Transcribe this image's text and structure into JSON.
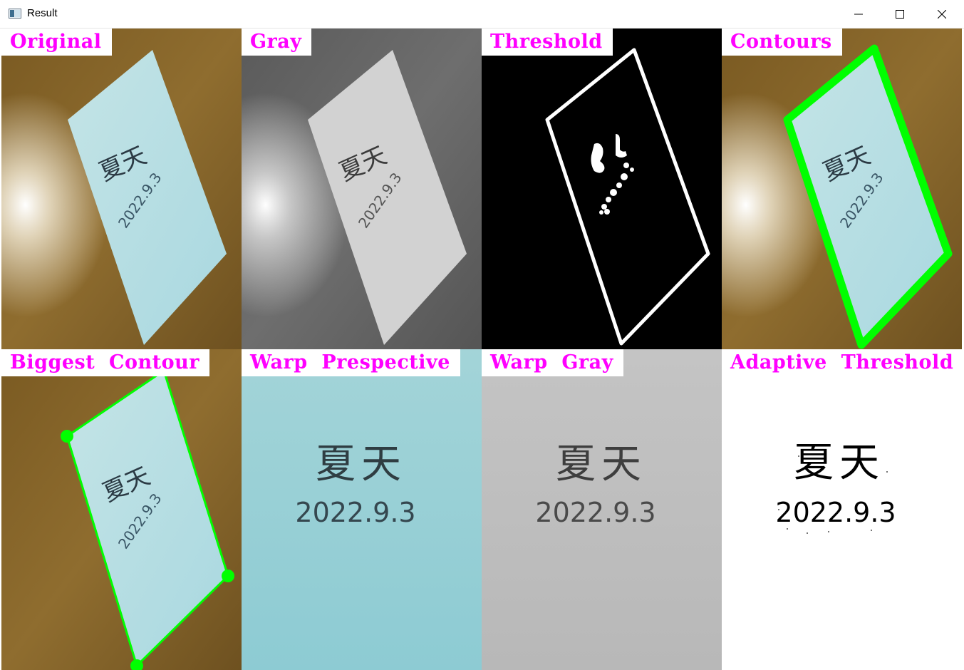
{
  "window": {
    "title": "Result",
    "buttons": {
      "minimize": "minimize",
      "maximize": "maximize",
      "close": "close"
    }
  },
  "panels": [
    {
      "label": "Original"
    },
    {
      "label": "Gray"
    },
    {
      "label": "Threshold"
    },
    {
      "label": "Contours"
    },
    {
      "label": "Biggest  Contour"
    },
    {
      "label": "Warp  Prespective"
    },
    {
      "label": "Warp  Gray"
    },
    {
      "label": "Adaptive  Threshold"
    }
  ],
  "document": {
    "characters": "夏天",
    "date": "2022.9.3"
  },
  "colors": {
    "label_text": "#ff00ff",
    "contour": "#00ff00",
    "paper": "#b7dde3",
    "table": "#8b6a2a"
  }
}
